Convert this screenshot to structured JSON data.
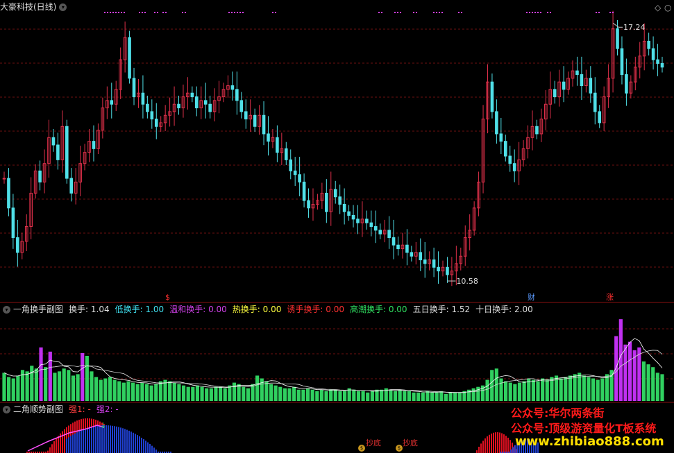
{
  "main": {
    "title": "大豪科技(日线)",
    "high_label": "17.24",
    "low_label": "10.58",
    "markers": [
      "$",
      "财",
      "涨"
    ]
  },
  "panel1": {
    "title": "一角换手副图",
    "items": [
      {
        "label": "换手:",
        "value": "1.04",
        "color": "#dddddd"
      },
      {
        "label": "低换手:",
        "value": "1.00",
        "color": "#40e0f0"
      },
      {
        "label": "温和换手:",
        "value": "0.00",
        "color": "#d040e8"
      },
      {
        "label": "热换手:",
        "value": "0.00",
        "color": "#ffff40"
      },
      {
        "label": "诱手换手:",
        "value": "0.00",
        "color": "#ff3030"
      },
      {
        "label": "高潮换手:",
        "value": "0.00",
        "color": "#30e060"
      },
      {
        "label": "五日换手:",
        "value": "1.52",
        "color": "#dddddd"
      },
      {
        "label": "十日换手:",
        "value": "2.00",
        "color": "#dddddd"
      }
    ]
  },
  "panel2": {
    "title": "二角顺势副图",
    "items": [
      {
        "label": "强1:",
        "value": "-",
        "color": "#ff4040"
      },
      {
        "label": "强2:",
        "value": "-",
        "color": "#d040e8"
      }
    ],
    "signals": [
      "抄底",
      "抄底"
    ]
  },
  "watermarks": [
    "公众号:华尔两条街",
    "公众号:顶级游资量化T板系统",
    "www.zhibiao888.com"
  ],
  "colors": {
    "up": "#e0304a",
    "down": "#50e0e8",
    "bar_green": "#30d060",
    "bar_purple": "#c030f0",
    "grid": "#6e1010"
  },
  "chart_data": [
    {
      "type": "candlestick",
      "price_series": [
        13.2,
        12.4,
        11.6,
        11.2,
        11.5,
        11.9,
        12.8,
        13.4,
        13.1,
        13.6,
        14.3,
        14.1,
        13.7,
        14.6,
        13.2,
        12.8,
        13.1,
        13.6,
        13.9,
        14.2,
        14.0,
        14.5,
        15.1,
        15.3,
        15.2,
        15.6,
        16.4,
        17.0,
        15.9,
        15.4,
        15.5,
        15.2,
        15.0,
        14.8,
        14.6,
        14.7,
        14.9,
        15.0,
        15.2,
        15.1,
        15.4,
        15.5,
        15.4,
        15.1,
        15.3,
        15.2,
        15.0,
        15.3,
        15.4,
        15.6,
        15.7,
        15.6,
        15.3,
        15.0,
        14.8,
        14.9,
        14.6,
        14.9,
        14.4,
        14.2,
        14.3,
        13.9,
        14.0,
        13.7,
        13.4,
        13.3,
        13.1,
        12.6,
        12.4,
        12.5,
        12.6,
        12.8,
        12.3,
        12.9,
        12.7,
        12.5,
        12.3,
        12.2,
        12.1,
        12.0,
        12.1,
        12.0,
        11.9,
        11.8,
        11.7,
        11.8,
        11.6,
        11.4,
        11.3,
        11.4,
        11.2,
        11.1,
        11.2,
        11.0,
        10.9,
        11.0,
        10.8,
        10.7,
        10.8,
        10.6,
        10.7,
        10.9,
        11.1,
        11.6,
        11.8,
        12.4,
        13.1,
        14.8,
        15.8,
        15.0,
        14.4,
        14.2,
        13.8,
        13.6,
        13.4,
        13.7,
        14.0,
        14.3,
        14.6,
        14.4,
        14.8,
        15.2,
        15.6,
        15.4,
        15.8,
        15.6,
        15.9,
        16.1,
        16.0,
        15.7,
        15.9,
        15.5,
        15.0,
        14.7,
        15.4,
        15.9,
        17.24,
        16.7,
        16.0,
        15.5,
        15.8,
        16.2,
        16.5,
        16.9,
        16.7,
        16.4,
        16.3,
        16.2
      ],
      "high": 17.24,
      "low": 10.58
    },
    {
      "type": "bar",
      "title": "一角换手副图",
      "values": [
        2.0,
        1.7,
        1.6,
        1.8,
        2.2,
        2.1,
        2.5,
        2.3,
        3.8,
        2.4,
        3.5,
        2.0,
        2.1,
        2.3,
        2.2,
        1.8,
        1.9,
        3.4,
        3.2,
        2.1,
        1.7,
        1.5,
        1.6,
        1.7,
        1.5,
        1.4,
        1.3,
        1.4,
        1.3,
        1.2,
        1.3,
        1.2,
        1.1,
        1.2,
        1.4,
        1.5,
        1.4,
        1.3,
        1.2,
        1.1,
        1.0,
        1.0,
        1.1,
        1.0,
        0.9,
        0.9,
        1.0,
        1.0,
        0.9,
        1.1,
        1.3,
        1.2,
        1.0,
        0.9,
        1.2,
        1.8,
        1.6,
        1.4,
        1.2,
        1.1,
        1.0,
        0.9,
        0.9,
        1.0,
        0.8,
        0.8,
        0.9,
        0.8,
        0.7,
        0.8,
        0.7,
        0.8,
        0.8,
        0.7,
        0.7,
        0.9,
        0.8,
        0.7,
        0.7,
        0.6,
        0.7,
        0.8,
        0.8,
        0.9,
        0.8,
        0.7,
        0.8,
        0.7,
        0.7,
        0.6,
        0.6,
        0.6,
        0.7,
        0.6,
        0.6,
        0.7,
        0.5,
        0.6,
        0.6,
        0.6,
        0.7,
        0.8,
        0.9,
        1.0,
        1.1,
        1.5,
        2.2,
        2.3,
        1.6,
        1.4,
        1.3,
        1.2,
        1.3,
        1.4,
        1.6,
        1.5,
        1.4,
        1.6,
        1.5,
        1.7,
        1.8,
        1.6,
        1.7,
        1.8,
        1.9,
        2.0,
        1.8,
        1.7,
        1.6,
        1.5,
        1.6,
        1.9,
        2.2,
        4.6,
        5.8,
        4.0,
        4.2,
        3.6,
        3.8,
        2.8,
        2.6,
        2.4,
        2.0,
        1.9
      ],
      "highlight": [
        8,
        10,
        17
      ]
    }
  ]
}
